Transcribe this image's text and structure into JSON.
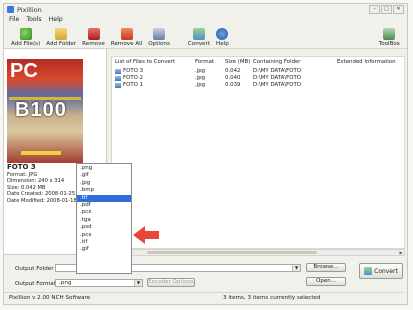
{
  "window": {
    "title": "Pixillion",
    "buttons": [
      "–",
      "□",
      "✕"
    ]
  },
  "menu": [
    "File",
    "Tools",
    "Help"
  ],
  "toolbar": {
    "items": [
      {
        "label": "Add File(s)",
        "icon": "add-file-icon"
      },
      {
        "label": "Add Folder",
        "icon": "add-folder-icon"
      },
      {
        "label": "Remove",
        "icon": "remove-icon"
      },
      {
        "label": "Remove All",
        "icon": "remove-all-icon"
      },
      {
        "label": "Options",
        "icon": "options-icon"
      },
      {
        "label": "Convert",
        "icon": "convert-icon"
      },
      {
        "label": "Help",
        "icon": "help-icon"
      }
    ],
    "toolbox": "ToolBox"
  },
  "preview": {
    "cover_logo": "PC",
    "cover_headline": "B100",
    "filename": "FOTO 3",
    "format": "Format: JPG",
    "dimension": "Dimension: 240 x 314",
    "size": "Size: 0.042 MB",
    "created": "Date Created: 2008-01-25",
    "modified": "Date Modified: 2008-01-18"
  },
  "list": {
    "columns": [
      "List of Files to Convert",
      "Format",
      "Size (MB)",
      "Containing Folder",
      "Extended Information"
    ],
    "rows": [
      {
        "name": "FOTO 3",
        "format": ".jpg",
        "size": "0.042",
        "folder": "D:\\MY DATA\\FOTO"
      },
      {
        "name": "FOTO 2",
        "format": ".jpg",
        "size": "0.040",
        "folder": "D:\\MY DATA\\FOTO"
      },
      {
        "name": "FOTO 1",
        "format": ".jpg",
        "size": "0.039",
        "folder": "D:\\MY DATA\\FOTO"
      }
    ]
  },
  "dropdown": {
    "options": [
      ".png",
      ".gif",
      ".jpg",
      ".bmp",
      ".tif",
      ".pdf",
      ".pcx",
      ".tga",
      ".psd",
      ".pcx",
      ".tif",
      ".gif"
    ],
    "selected_index": 4
  },
  "bottom": {
    "output_folder_label": "Output Folder",
    "output_format_label": "Output Format",
    "output_format_value": ".png",
    "encoder_button": "Encoder Options",
    "browse_button": "Browse...",
    "open_button": "Open...",
    "convert_button": "Convert"
  },
  "status": {
    "version": "Pixillion v 2.00 NCH Software",
    "selection": "3 items, 3 items currently selected"
  },
  "colors": {
    "highlight": "#2f6ed6",
    "arrow": "#e8463a"
  }
}
